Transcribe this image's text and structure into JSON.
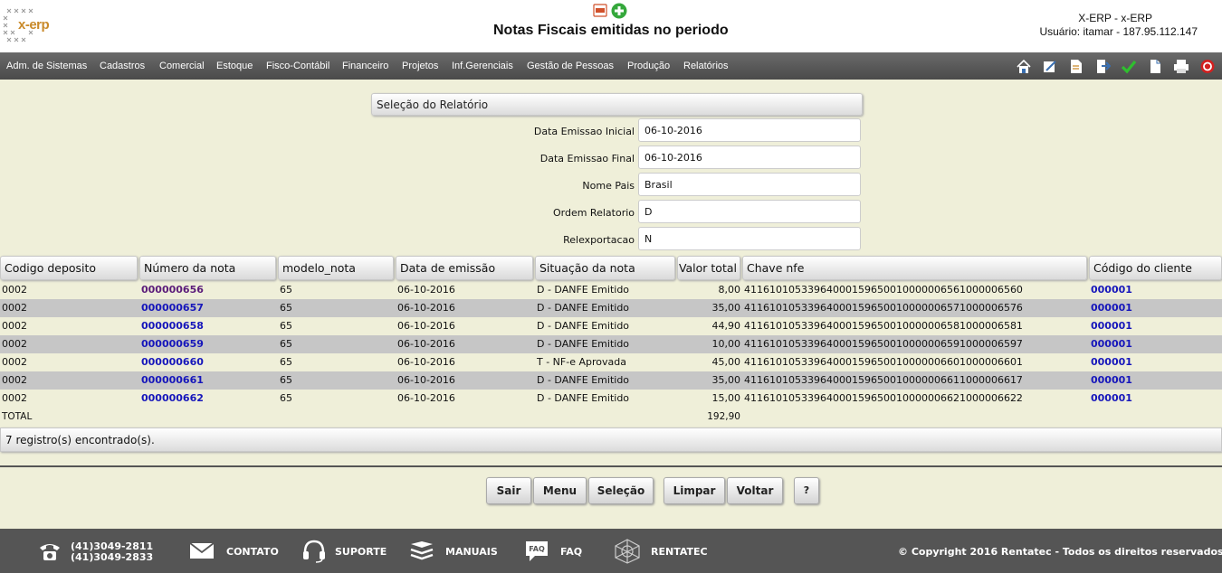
{
  "header": {
    "logo_text": "x-erp",
    "title": "Notas Fiscais emitidas no periodo",
    "company": "X-ERP - x-ERP",
    "user_info": "Usuário: itamar - 187.95.112.147"
  },
  "menu": {
    "items": [
      "Adm. de Sistemas",
      "Cadastros",
      "Comercial",
      "Estoque",
      "Fisco-Contábil",
      "Financeiro",
      "Projetos",
      "Inf.Gerenciais",
      "Gestão de Pessoas",
      "Produção",
      "Relatórios"
    ],
    "toolbar_icons": [
      "home-icon",
      "edit-icon",
      "document-icon",
      "export-icon",
      "check-icon",
      "page-icon",
      "print-icon",
      "exit-icon"
    ]
  },
  "selection": {
    "title": "Seleção do Relatório",
    "fields": [
      {
        "label": "Data Emissao Inicial",
        "value": "06-10-2016"
      },
      {
        "label": "Data Emissao Final",
        "value": "06-10-2016"
      },
      {
        "label": "Nome Pais",
        "value": "Brasil"
      },
      {
        "label": "Ordem Relatorio",
        "value": "D"
      },
      {
        "label": "Relexportacao",
        "value": "N"
      }
    ]
  },
  "table": {
    "columns": [
      "Codigo deposito",
      "Número da nota",
      "modelo_nota",
      "Data de emissão",
      "Situação da nota",
      "Valor total",
      "Chave nfe",
      "Código do cliente"
    ],
    "rows": [
      {
        "deposito": "0002",
        "numero": "000000656",
        "modelo": "65",
        "data": "06-10-2016",
        "situacao": "D - DANFE Emitido",
        "valor": "8,00",
        "chave": "41161010533964000159650010000006561000006560",
        "cliente": "000001"
      },
      {
        "deposito": "0002",
        "numero": "000000657",
        "modelo": "65",
        "data": "06-10-2016",
        "situacao": "D - DANFE Emitido",
        "valor": "35,00",
        "chave": "41161010533964000159650010000006571000006576",
        "cliente": "000001"
      },
      {
        "deposito": "0002",
        "numero": "000000658",
        "modelo": "65",
        "data": "06-10-2016",
        "situacao": "D - DANFE Emitido",
        "valor": "44,90",
        "chave": "41161010533964000159650010000006581000006581",
        "cliente": "000001"
      },
      {
        "deposito": "0002",
        "numero": "000000659",
        "modelo": "65",
        "data": "06-10-2016",
        "situacao": "D - DANFE Emitido",
        "valor": "10,00",
        "chave": "41161010533964000159650010000006591000006597",
        "cliente": "000001"
      },
      {
        "deposito": "0002",
        "numero": "000000660",
        "modelo": "65",
        "data": "06-10-2016",
        "situacao": "T - NF-e Aprovada",
        "valor": "45,00",
        "chave": "41161010533964000159650010000006601000006601",
        "cliente": "000001"
      },
      {
        "deposito": "0002",
        "numero": "000000661",
        "modelo": "65",
        "data": "06-10-2016",
        "situacao": "D - DANFE Emitido",
        "valor": "35,00",
        "chave": "41161010533964000159650010000006611000006617",
        "cliente": "000001"
      },
      {
        "deposito": "0002",
        "numero": "000000662",
        "modelo": "65",
        "data": "06-10-2016",
        "situacao": "D - DANFE Emitido",
        "valor": "15,00",
        "chave": "41161010533964000159650010000006621000006622",
        "cliente": "000001"
      }
    ],
    "total_label": "TOTAL",
    "total_value": "192,90",
    "found_text": "7 registro(s) encontrado(s)."
  },
  "buttons": {
    "sair": "Sair",
    "menu": "Menu",
    "selecao": "Seleção",
    "limpar": "Limpar",
    "voltar": "Voltar",
    "help": "?"
  },
  "footer": {
    "phone1": "(41)3049-2811",
    "phone2": "(41)3049-2833",
    "contato": "CONTATO",
    "suporte": "SUPORTE",
    "manuais": "MANUAIS",
    "faq": "FAQ",
    "rentatec": "RENTATEC",
    "copyright": "© Copyright 2016 Rentatec - Todos os direitos reservados"
  }
}
